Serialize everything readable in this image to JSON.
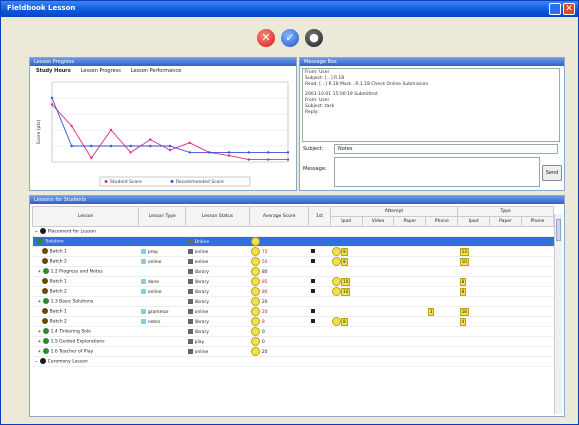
{
  "window": {
    "title": "Fieldbook Lesson",
    "close_glyph": "✕"
  },
  "toolbar": {
    "btn1_glyph": "✕",
    "btn2_glyph": "✓",
    "btn3_glyph": "●"
  },
  "progress_panel": {
    "title": "Lesson Progress",
    "tabs": [
      "Study Hours",
      "Lesson Progress",
      "Lesson Performance"
    ],
    "ylabel": "Score (pts)",
    "legend": [
      "Student Score",
      "Recommended Score"
    ]
  },
  "chart_data": {
    "type": "line",
    "x": [
      1,
      2,
      3,
      4,
      5,
      6,
      7,
      8,
      9,
      10,
      11,
      12,
      13
    ],
    "ylim": [
      0,
      100
    ],
    "series": [
      {
        "name": "Student Score",
        "color": "#d62f8a",
        "values": [
          72,
          45,
          5,
          40,
          12,
          28,
          15,
          24,
          12,
          8,
          3,
          3,
          3
        ]
      },
      {
        "name": "Recommended Score",
        "color": "#3a4fd6",
        "values": [
          80,
          20,
          20,
          20,
          20,
          20,
          20,
          12,
          12,
          12,
          12,
          12,
          12
        ]
      }
    ]
  },
  "message_panel": {
    "title": "Message Box",
    "lines": [
      "From:  User",
      "Subject:  [...] R.18",
      "Read:   [...] R.18   Mark...R.1.18   Check Online Submission",
      "",
      "2003-10-01 15:00:19  Submitted",
      "From:  User",
      "Subject:  task",
      "Reply:"
    ],
    "subject_label": "Subject:",
    "subject_value": "Notes",
    "message_label": "Message:",
    "send_label": "Send"
  },
  "table_panel": {
    "title": "Lessons for Students",
    "headers": {
      "lesson": "Lesson",
      "type": "Lesson Type",
      "status": "Lesson Status",
      "score": "Average Score",
      "col1": "1st",
      "grp_a": "Attempt",
      "grp_b": "Type",
      "sub": [
        "Ipad",
        "Video",
        "Paper",
        "Phone",
        "Ipad",
        "Paper",
        "Phone"
      ]
    },
    "rows": [
      {
        "kind": "group",
        "label": "Placement for Lesson"
      },
      {
        "kind": "selected",
        "label": "Solution",
        "status": "Online"
      },
      {
        "kind": "item",
        "label": "Batch 1",
        "type": "prep",
        "status": "online",
        "score": "75",
        "a": "8",
        "b": "13"
      },
      {
        "kind": "item",
        "label": "Batch 2",
        "type": "online",
        "status": "online",
        "score": "50",
        "a": "8",
        "b": "10"
      },
      {
        "kind": "sub",
        "label": "1.2  Progress and Notes",
        "status": "library",
        "score": "80"
      },
      {
        "kind": "item",
        "label": "Batch 1",
        "type": "done",
        "status": "library",
        "score": "85",
        "a": "10",
        "b": "8"
      },
      {
        "kind": "item",
        "label": "Batch 2",
        "type": "online",
        "status": "library",
        "score": "80",
        "a": "10",
        "b": "8"
      },
      {
        "kind": "sub",
        "label": "1.3  Basic Solutions",
        "status": "library",
        "score": "20"
      },
      {
        "kind": "item",
        "label": "Batch 1",
        "type": "grammar",
        "status": "online",
        "score": "20",
        "a": "",
        "b": "18",
        "c": "3"
      },
      {
        "kind": "item",
        "label": "Batch 2",
        "type": "notes",
        "status": "library",
        "score": "8",
        "a": "8",
        "b": "4"
      },
      {
        "kind": "sub",
        "label": "1.4  Tinkering Solo",
        "status": "library",
        "score": "0"
      },
      {
        "kind": "sub",
        "label": "1.5  Guided Explorations",
        "status": "play",
        "score": "0"
      },
      {
        "kind": "sub",
        "label": "1.6  Teacher of Play",
        "status": "online",
        "score": "20"
      },
      {
        "kind": "group",
        "label": "Ceremony Lesson"
      }
    ]
  }
}
